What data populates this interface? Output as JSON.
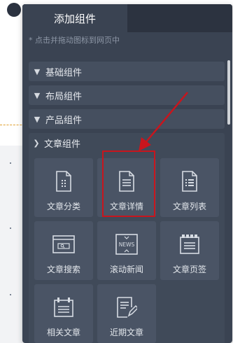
{
  "panel": {
    "title": "添加组件",
    "hint": "* 点击并拖动图标到网页中"
  },
  "sections": [
    {
      "label": "基础组件",
      "expanded": false
    },
    {
      "label": "布局组件",
      "expanded": false
    },
    {
      "label": "产品组件",
      "expanded": false
    },
    {
      "label": "文章组件",
      "expanded": true
    }
  ],
  "article_items": [
    {
      "label": "文章分类",
      "icon": "article-category-icon"
    },
    {
      "label": "文章详情",
      "icon": "article-detail-icon"
    },
    {
      "label": "文章列表",
      "icon": "article-list-icon"
    },
    {
      "label": "文章搜索",
      "icon": "article-search-icon"
    },
    {
      "label": "滚动新闻",
      "icon": "news-icon"
    },
    {
      "label": "文章页签",
      "icon": "article-tabs-icon"
    },
    {
      "label": "相关文章",
      "icon": "related-article-icon"
    },
    {
      "label": "近期文章",
      "icon": "recent-article-icon"
    }
  ],
  "news_icon_text": "NEWS",
  "colors": {
    "panel_bg": "#3a4352",
    "tab_bar": "#2c3340",
    "section_bg": "#454f5f",
    "item_bg": "#4a5465",
    "highlight": "#c8151d"
  }
}
